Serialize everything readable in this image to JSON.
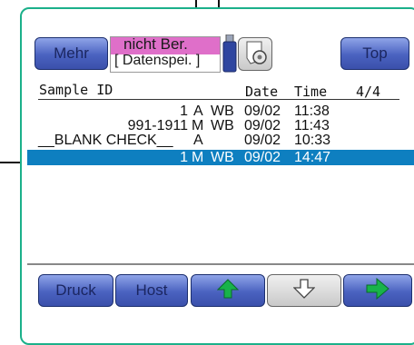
{
  "toolbar_top": {
    "more_label": "Mehr",
    "status_top": "nicht Ber.",
    "status_bottom": "[ Datenspei. ]",
    "top_label": "Top"
  },
  "icons": {
    "usb": "usb-stick-icon",
    "printer": "printer-paper-roll-icon"
  },
  "table": {
    "col_sample": "Sample ID",
    "col_date": "Date",
    "col_time": "Time",
    "page": "4/4",
    "rows": [
      {
        "id": "1",
        "mode": "A",
        "type": "WB",
        "date": "09/02",
        "time": "11:38",
        "selected": false
      },
      {
        "id": "991-1911",
        "mode": "M",
        "type": "WB",
        "date": "09/02",
        "time": "11:43",
        "selected": false
      },
      {
        "id": "__BLANK CHECK__",
        "mode": "A",
        "type": "",
        "date": "09/02",
        "time": "10:33",
        "selected": false
      },
      {
        "id": "1",
        "mode": "M",
        "type": "WB",
        "date": "09/02",
        "time": "14:47",
        "selected": true
      }
    ]
  },
  "bottom_toolbar": {
    "print_label": "Druck",
    "host_label": "Host"
  },
  "colors": {
    "frame": "#1bb08a",
    "selected_row": "#0e7fc0",
    "status_pink": "#df6fc9",
    "button_blue": "#4a62c0",
    "arrow_green": "#18b34a"
  }
}
